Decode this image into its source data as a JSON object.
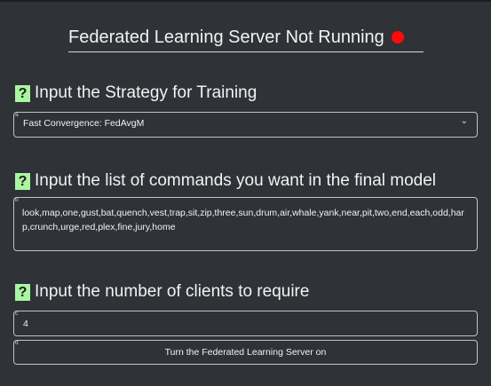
{
  "status": {
    "title": "Federated Learning Server Not Running",
    "indicator_color": "#ff0a0a"
  },
  "help_icon_glyph": "?",
  "strategy": {
    "heading": "Input the Strategy for Training",
    "tag": "a",
    "selected": "Fast Convergence: FedAvgM"
  },
  "commands": {
    "heading": "Input the list of commands you want in the final model",
    "tag": "b",
    "value": "look,map,one,gust,bat,quench,vest,trap,sit,zip,three,sun,drum,air,whale,yank,near,pit,two,end,each,odd,harp,crunch,urge,red,plex,fine,jury,home"
  },
  "clients": {
    "heading": "Input the number of clients to require",
    "tag": "c",
    "value": "4"
  },
  "server_button": {
    "tag": "d",
    "label": "Turn the Federated Learning Server on"
  }
}
